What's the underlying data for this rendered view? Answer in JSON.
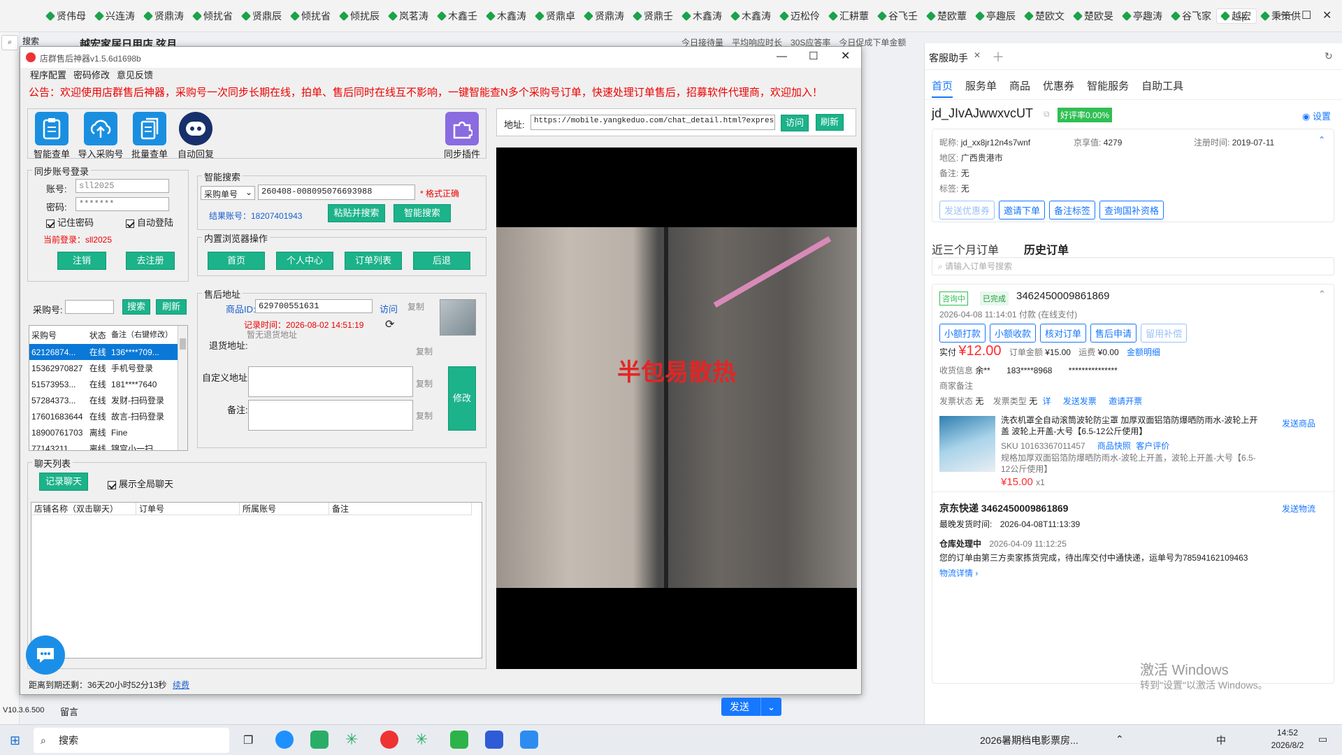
{
  "tabs": [
    "贤伟母",
    "兴连涛",
    "贤鼎涛",
    "倾扰省",
    "贤鼎辰",
    "倾扰省",
    "倾扰辰",
    "岚茗涛",
    "木鑫壬",
    "木鑫涛",
    "贤鼎卓",
    "贤鼎涛",
    "贤鼎壬",
    "木鑫涛",
    "木鑫涛",
    "迈松伶",
    "汇耕蕈",
    "谷飞壬",
    "楚欧蕈",
    "亭趣辰",
    "楚欧文",
    "楚欧旻",
    "亭趣涛",
    "谷飞家",
    "越宏",
    "秉策供"
  ],
  "bg": {
    "search": "搜索",
    "shop": "越宏家居日用店 弦月",
    "stats": [
      "今日接待量",
      "平均响应时长",
      "30S应答率",
      "今日促成下单金额"
    ]
  },
  "dialog": {
    "title": "店群售后神器v1.5.6d1698b",
    "menu": [
      "程序配置",
      "密码修改",
      "意见反馈"
    ],
    "notice": "公告：欢迎使用店群售后神器，采购号一次同步长期在线，拍单、售后同时在线互不影响，一键智能查N多个采购号订单，快速处理订单售后，招募软件代理商，欢迎加入！",
    "tools": [
      "智能查单",
      "导入采购号",
      "批量查单",
      "自动回复"
    ],
    "plugin": "同步插件",
    "login": {
      "legend": "同步账号登录",
      "acc_lbl": "账号:",
      "acc": "sll2025",
      "pwd_lbl": "密码:",
      "pwd": "*******",
      "remember": "记住密码",
      "autologin": "自动登陆",
      "current": "当前登录：sll2025",
      "logout": "注销",
      "register": "去注册"
    },
    "search": {
      "legend": "智能搜索",
      "type": "采购单号",
      "value": "260408-008095076693988",
      "status": "* 格式正确",
      "result": "结果账号：18207401943",
      "paste_btn": "粘贴并搜索",
      "smart_btn": "智能搜索"
    },
    "browser": {
      "legend": "内置浏览器操作",
      "btns": [
        "首页",
        "个人中心",
        "订单列表",
        "后退"
      ]
    },
    "buyer": {
      "label": "采购号:",
      "search": "搜索",
      "refresh": "刷新",
      "headers": [
        "采购号",
        "状态",
        "备注（右键修改）"
      ],
      "rows": [
        [
          "62126874...",
          "在线",
          "136****709..."
        ],
        [
          "15362970827",
          "在线",
          "手机号登录"
        ],
        [
          "51573953...",
          "在线",
          "181****7640"
        ],
        [
          "57284373...",
          "在线",
          "发财-扫码登录"
        ],
        [
          "17601683644",
          "在线",
          "故言-扫码登录"
        ],
        [
          "18900761703",
          "离线",
          "Fine"
        ],
        [
          "77143211...",
          "离线",
          "锦宫小一扫..."
        ]
      ]
    },
    "aftersale": {
      "legend": "售后地址",
      "pid_lbl": "商品ID:",
      "pid": "629700551631",
      "visit": "访问",
      "copy": "复制",
      "time": "记录时间：2026-08-02 14:51:19",
      "ret_lbl": "退货地址:",
      "ret": "暂无退货地址",
      "custom_lbl": "自定义地址:",
      "note_lbl": "备注:",
      "modify": "修改"
    },
    "chat": {
      "legend": "聊天列表",
      "record": "记录聊天",
      "showall": "展示全局聊天",
      "headers": [
        "店铺名称（双击聊天）",
        "订单号",
        "所属账号",
        "备注"
      ]
    },
    "url": {
      "label": "地址:",
      "value": "https://mobile.yangkeduo.com/chat_detail.html?express_orde",
      "visit": "访问",
      "refresh": "刷新"
    },
    "img_caption": "半包易散热",
    "expire": "距离到期还剩：36天20小时52分13秒",
    "renew": "续费"
  },
  "rp": {
    "title": "客服助手",
    "tabs": [
      "首页",
      "服务单",
      "商品",
      "优惠券",
      "智能服务",
      "自助工具"
    ],
    "user": "jd_JIvAJwwxvcUT",
    "rate": "好评率0.00%",
    "settings": "设置",
    "nick_lbl": "昵称:",
    "nick": "jd_xx8jr12n4s7wnf",
    "jx_lbl": "京享值:",
    "jx": "4279",
    "reg_lbl": "注册时间:",
    "reg": "2019-07-11",
    "area_lbl": "地区:",
    "area": "广西贵港市",
    "note_lbl": "备注:",
    "note": "无",
    "tag_lbl": "标签:",
    "tag": "无",
    "actions": [
      "发送优惠券",
      "邀请下单",
      "备注标签",
      "查询国补资格"
    ],
    "order_tabs": [
      "近三个月订单",
      "历史订单"
    ],
    "order_search": "请输入订单号搜索",
    "order": {
      "consult": "咨询中",
      "done": "已完成",
      "id": "3462450009861869",
      "time": "2026-04-08 11:14:01 付款",
      "pay": "(在线支付)",
      "btns": [
        "小额打款",
        "小额收款",
        "核对订单",
        "售后申请",
        "留用补偿"
      ],
      "paid_lbl": "实付",
      "paid": "¥12.00",
      "total_lbl": "订单金额",
      "total": "¥15.00",
      "freight_lbl": "运费",
      "freight": "¥0.00",
      "detail": "金额明细",
      "recv_lbl": "收货信息",
      "recv_name": "余**",
      "recv_phone": "183****8968",
      "recv_addr": "***************",
      "merchant_note": "商家备注",
      "inv_lbl": "发票状态",
      "inv": "无",
      "invtype_lbl": "发票类型",
      "invtype": "无",
      "inv_detail": "详",
      "send_inv": "发送发票",
      "invite_inv": "邀请开票",
      "product": "洗衣机罩全自动滚筒波轮防尘罩 加厚双面铝箔防爆晒防雨水-波轮上开盖 波轮上开盖-大号【6.5-12公斤使用】",
      "send_product": "发送商品",
      "sku_lbl": "SKU",
      "sku": "10163367011457",
      "snapshot": "商品快照",
      "review": "客户评价",
      "spec": "规格加厚双面铝箔防爆晒防雨水-波轮上开盖，波轮上开盖-大号【6.5-12公斤使用】",
      "price": "¥15.00",
      "qty": "x1",
      "ship_title": "京东快递 3462450009861869",
      "send_ship": "发送物流",
      "last_ship_lbl": "最晚发货时间:",
      "last_ship": "2026-04-08T11:13:39",
      "wh": "仓库处理中",
      "wh_time": "2026-04-09 11:12:25",
      "wh_msg": "您的订单由第三方卖家拣货完成，待出库交付中通快递，运单号为78594162109463",
      "track": "物流详情"
    }
  },
  "bottom": {
    "version": "V10.3.6.500",
    "leave": "留言",
    "send": "发送",
    "activate1": "激活 Windows",
    "activate2": "转到\"设置\"以激活 Windows。"
  },
  "taskbar": {
    "search": "搜索",
    "news": "2026暑期档电影票房...",
    "ime": "中",
    "time": "14:52",
    "date": "2026/8/2"
  },
  "colors": {
    "accent": "#1cb28a",
    "notice": "#e00000",
    "blue": "#1677ff",
    "price": "#ff2b2b"
  }
}
